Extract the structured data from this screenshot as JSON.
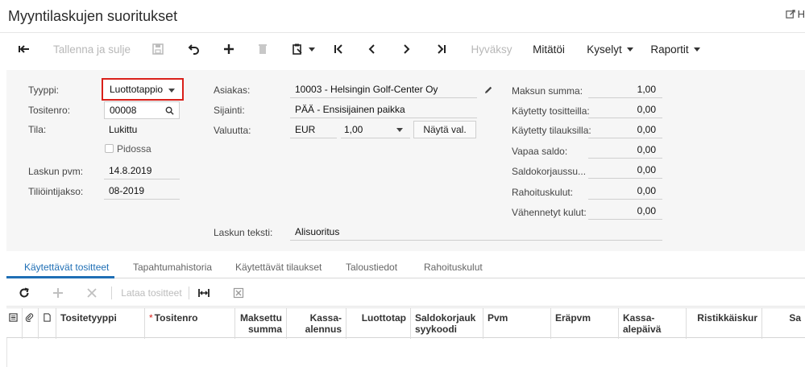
{
  "page": {
    "title": "Myyntilaskujen suoritukset",
    "corner_link": "H"
  },
  "toolbar": {
    "save_close": "Tallenna ja sulje",
    "approve": "Hyväksy",
    "void": "Mitätöi",
    "inquiries": "Kyselyt",
    "reports": "Raportit"
  },
  "form": {
    "type_label": "Tyyppi:",
    "type_value": "Luottotappio",
    "docno_label": "Tositenro:",
    "docno_value": "00008",
    "status_label": "Tila:",
    "status_value": "Lukittu",
    "hold_label": "Pidossa",
    "date_label": "Laskun pvm:",
    "date_value": "14.8.2019",
    "period_label": "Tiliöintijakso:",
    "period_value": "08-2019",
    "customer_label": "Asiakas:",
    "customer_value": "10003 - Helsingin Golf-Center Oy",
    "location_label": "Sijainti:",
    "location_value": "PÄÄ - Ensisijainen paikka",
    "currency_label": "Valuutta:",
    "currency_value": "EUR",
    "rate_value": "1,00",
    "show_rate_button": "Näytä val.",
    "invoice_text_label": "Laskun teksti:",
    "invoice_text_value": "Alisuoritus",
    "totals": [
      {
        "label": "Maksun summa:",
        "value": "1,00"
      },
      {
        "label": "Käytetty tositteilla:",
        "value": "0,00"
      },
      {
        "label": "Käytetty tilauksilla:",
        "value": "0,00"
      },
      {
        "label": "Vapaa saldo:",
        "value": "0,00"
      },
      {
        "label": "Saldokorjaussu...",
        "value": "0,00"
      },
      {
        "label": "Rahoituskulut:",
        "value": "0,00"
      },
      {
        "label": "Vähennetyt kulut:",
        "value": "0,00"
      }
    ]
  },
  "tabs": [
    "Käytettävät tositteet",
    "Tapahtumahistoria",
    "Käytettävät tilaukset",
    "Taloustiedot",
    "Rahoituskulut"
  ],
  "grid_toolbar": {
    "load_docs": "Lataa tositteet"
  },
  "grid": {
    "columns": [
      "Tositetyyppi",
      "Tositenro",
      "Maksettu summa",
      "Kassa-alennus",
      "Luottotap",
      "Saldokorjauk syykoodi",
      "Pvm",
      "Eräpvm",
      "Kassa-alepäivä",
      "Ristikkäiskur",
      "Sa"
    ]
  }
}
